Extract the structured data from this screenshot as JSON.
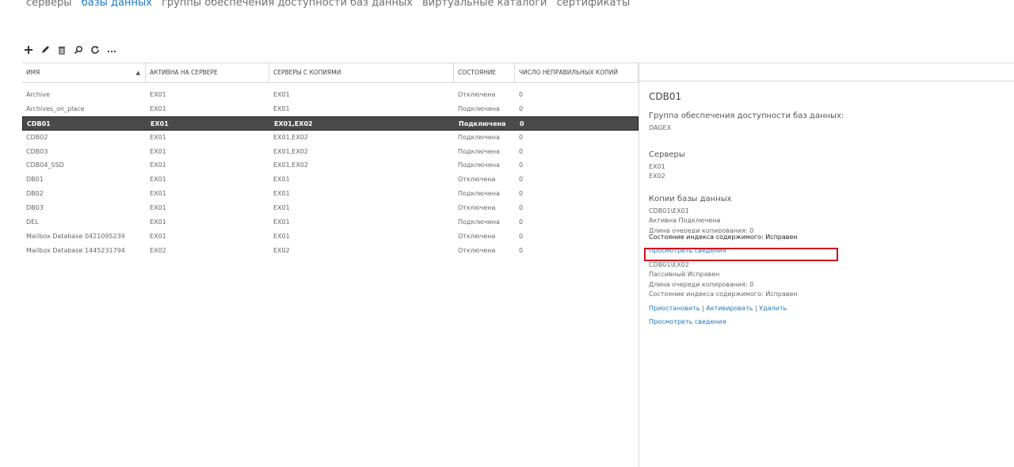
{
  "nav": {
    "items": [
      "серверы",
      "базы данных",
      "группы обеспечения доступности баз данных",
      "виртуальные каталоги",
      "сертификаты"
    ],
    "active_index": 1
  },
  "toolbar": {
    "icons": [
      "add-icon",
      "edit-icon",
      "delete-icon",
      "search-icon",
      "refresh-icon",
      "more-icon"
    ]
  },
  "grid": {
    "columns": [
      "ИМЯ",
      "АКТИВНА НА СЕРВЕРЕ",
      "СЕРВЕРЫ С КОПИЯМИ",
      "СОСТОЯНИЕ",
      "ЧИСЛО НЕПРАВИЛЬНЫХ КОПИЙ"
    ],
    "sort_indicator": "▲",
    "selected_index": 2,
    "rows": [
      [
        "Archive",
        "EX01",
        "EX01",
        "Отключена",
        "0"
      ],
      [
        "Archives_on_place",
        "EX01",
        "EX01",
        "Подключена",
        "0"
      ],
      [
        "CDB01",
        "EX01",
        "EX01,EX02",
        "Подключена",
        "0"
      ],
      [
        "CDB02",
        "EX01",
        "EX01,EX02",
        "Подключена",
        "0"
      ],
      [
        "CDB03",
        "EX01",
        "EX01,EX02",
        "Подключена",
        "0"
      ],
      [
        "CDB04_SSD",
        "EX01",
        "EX01,EX02",
        "Подключена",
        "0"
      ],
      [
        "DB01",
        "EX01",
        "EX01",
        "Отключена",
        "0"
      ],
      [
        "DB02",
        "EX01",
        "EX01",
        "Подключена",
        "0"
      ],
      [
        "DB03",
        "EX01",
        "EX01",
        "Отключена",
        "0"
      ],
      [
        "DEL",
        "EX01",
        "EX01",
        "Подключена",
        "0"
      ],
      [
        "Mailbox Database 0421095234",
        "EX01",
        "EX01",
        "Отключена",
        "0"
      ],
      [
        "Mailbox Database 1445231794",
        "EX02",
        "EX02",
        "Отключена",
        "0"
      ]
    ]
  },
  "details": {
    "title": "CDB01",
    "dag_label": "Группа обеспечения доступности баз данных:",
    "dag_value": "DAGEX",
    "servers_label": "Серверы",
    "servers": [
      "EX01",
      "EX02"
    ],
    "copies_label": "Копии базы данных",
    "copy1": {
      "name": "CDB01\\EX01",
      "status": " Активна Подключена",
      "queue": "Длина очереди копирования: 0",
      "index": "Состояние индекса содержимого: Исправен",
      "view_link": "Просмотреть сведения"
    },
    "copy2": {
      "name": "CDB01\\EX02",
      "status": " Пассивный Исправен",
      "queue": "Длина очереди копирования: 0",
      "index": "Состояние индекса содержимого: Исправен",
      "suspend_link": "Приостановить",
      "activate_link": "Активировать",
      "delete_link": "Удалить",
      "separator": "|",
      "view_link": "Просмотреть сведения"
    }
  },
  "colors": {
    "accent": "#1e78c2",
    "highlight_border": "#d0101a",
    "selected_row": "#4a4a4a"
  }
}
